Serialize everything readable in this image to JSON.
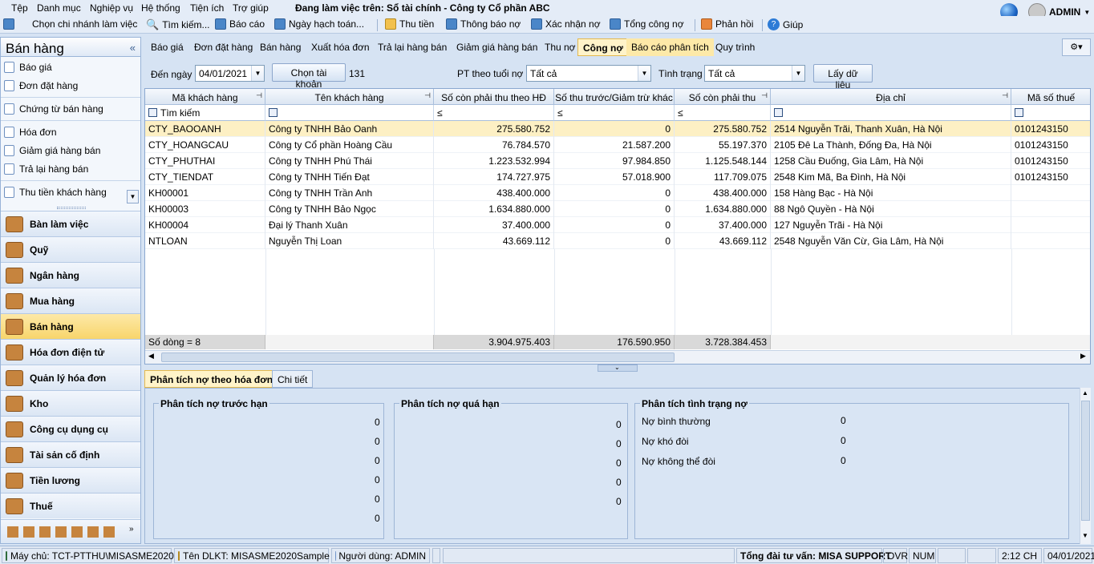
{
  "menu": [
    "Tệp",
    "Danh mục",
    "Nghiệp vụ",
    "Hệ thống",
    "Tiện ích",
    "Trợ giúp"
  ],
  "working_on": "Đang làm việc trên: Sổ tài chính - Công ty Cổ phần ABC",
  "user": "ADMIN",
  "toolbar": [
    "Chọn chi nhánh làm việc",
    "Tìm kiếm...",
    "Báo cáo",
    "Ngày hạch toán...",
    "Thu tiền",
    "Thông báo nợ",
    "Xác nhận nợ",
    "Tổng công nợ",
    "Phản hồi",
    "Giúp"
  ],
  "left": {
    "title": "Bán hàng",
    "collapse": "«",
    "links": [
      "Báo giá",
      "Đơn đặt hàng",
      "Chứng từ bán hàng",
      "Hóa đơn",
      "Giảm giá hàng bán",
      "Trả lại hàng bán",
      "Thu tiền khách hàng"
    ],
    "nav": [
      "Bàn làm việc",
      "Quỹ",
      "Ngân hàng",
      "Mua hàng",
      "Bán hàng",
      "Hóa đơn điện tử",
      "Quản lý hóa đơn",
      "Kho",
      "Công cụ dụng cụ",
      "Tài sản cố định",
      "Tiền lương",
      "Thuế"
    ],
    "selected_nav": "Bán hàng"
  },
  "tabs": [
    "Báo giá",
    "Đơn đặt hàng",
    "Bán hàng",
    "Xuất hóa đơn",
    "Trả lại hàng bán",
    "Giảm giá hàng bán",
    "Thu nợ",
    "Công nợ",
    "Báo cáo phân tích",
    "Quy trình"
  ],
  "active_tab": "Công nợ",
  "filter": {
    "to_date_label": "Đến ngày",
    "to_date": "04/01/2021",
    "choose_account": "Chọn tài khoản",
    "account": "131",
    "age_label": "PT theo tuổi nợ",
    "age_value": "Tất cả",
    "status_label": "Tình trạng",
    "status_value": "Tất cả",
    "fetch": "Lấy dữ liệu"
  },
  "grid": {
    "headers": [
      "Mã khách hàng",
      "Tên khách hàng",
      "Số còn phải thu theo HĐ",
      "Số thu trước/Giảm trừ khác",
      "Số còn phải thu",
      "Địa chỉ",
      "Mã số thuế"
    ],
    "search_placeholder": "Tìm kiếm",
    "filter_ops": [
      "≤",
      "≤",
      "≤"
    ],
    "rows": [
      [
        "CTY_BAOOANH",
        "Công ty TNHH Bảo Oanh",
        "275.580.752",
        "0",
        "275.580.752",
        "2514 Nguyễn Trãi, Thanh Xuân, Hà Nội",
        "0101243150"
      ],
      [
        "CTY_HOANGCAU",
        "Công ty Cổ phần Hoàng Cầu",
        "76.784.570",
        "21.587.200",
        "55.197.370",
        "2105 Đê La Thành, Đống Đa, Hà Nội",
        "0101243150"
      ],
      [
        "CTY_PHUTHAI",
        "Công ty TNHH Phú Thái",
        "1.223.532.994",
        "97.984.850",
        "1.125.548.144",
        "1258 Cầu Đuống, Gia Lâm, Hà Nội",
        "0101243150"
      ],
      [
        "CTY_TIENDAT",
        "Công ty TNHH Tiến Đạt",
        "174.727.975",
        "57.018.900",
        "117.709.075",
        "2548 Kim Mã, Ba Đình, Hà Nội",
        "0101243150"
      ],
      [
        "KH00001",
        "Công ty TNHH Trần Anh",
        "438.400.000",
        "0",
        "438.400.000",
        "158 Hàng Bạc - Hà Nội",
        ""
      ],
      [
        "KH00003",
        "Công ty TNHH Bảo Ngọc",
        "1.634.880.000",
        "0",
        "1.634.880.000",
        "88 Ngô Quyền - Hà Nội",
        ""
      ],
      [
        "KH00004",
        "Đại lý Thanh Xuân",
        "37.400.000",
        "0",
        "37.400.000",
        "127 Nguyễn Trãi - Hà Nội",
        ""
      ],
      [
        "NTLOAN",
        "Nguyễn Thị Loan",
        "43.669.112",
        "0",
        "43.669.112",
        "2548 Nguyễn Văn Cừ, Gia Lâm, Hà Nội",
        ""
      ]
    ],
    "row_count": "Số dòng = 8",
    "totals": [
      "3.904.975.403",
      "176.590.950",
      "3.728.384.453"
    ]
  },
  "bottom_tabs": [
    "Phân tích nợ theo hóa đơn",
    "Chi tiết"
  ],
  "groups": [
    {
      "title": "Phân tích nợ trước hạn",
      "values": [
        "0",
        "0",
        "0",
        "0",
        "0",
        "0"
      ]
    },
    {
      "title": "Phân tích nợ quá hạn",
      "values": [
        "0",
        "0",
        "0",
        "0",
        "0"
      ]
    },
    {
      "title": "Phân tích tình trạng nợ",
      "labels": [
        "Nợ bình thường",
        "Nợ khó đòi",
        "Nợ không thể đòi"
      ],
      "values": [
        "0",
        "0",
        "0"
      ]
    }
  ],
  "status": {
    "server": "Máy chủ: TCT-PTTHU\\MISASME2020",
    "db": "Tên DLKT: MISASME2020Sample",
    "user": "Người dùng: ADMIN",
    "support": "Tổng đài tư vấn: MISA SUPPORT",
    "ovr": "OVR",
    "num": "NUM",
    "time": "2:12 CH",
    "date": "04/01/2021"
  }
}
